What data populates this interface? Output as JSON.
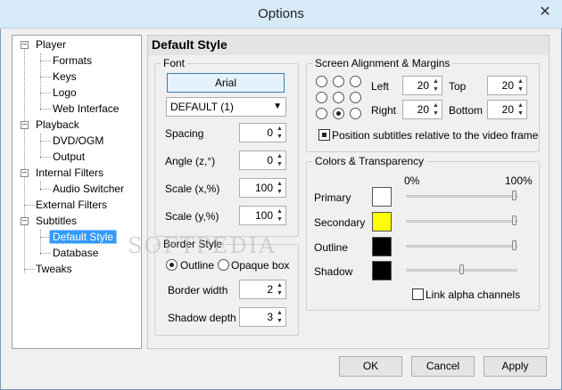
{
  "window": {
    "title": "Options",
    "close_glyph": "✕"
  },
  "tree": {
    "items": [
      {
        "label": "Player",
        "expander": "−"
      },
      {
        "label": "Formats"
      },
      {
        "label": "Keys"
      },
      {
        "label": "Logo"
      },
      {
        "label": "Web Interface"
      },
      {
        "label": "Playback",
        "expander": "−"
      },
      {
        "label": "DVD/OGM"
      },
      {
        "label": "Output"
      },
      {
        "label": "Internal Filters",
        "expander": "−"
      },
      {
        "label": "Audio Switcher"
      },
      {
        "label": "External Filters"
      },
      {
        "label": "Subtitles",
        "expander": "−"
      },
      {
        "label": "Default Style",
        "selected": true
      },
      {
        "label": "Database"
      },
      {
        "label": "Tweaks"
      }
    ]
  },
  "panel": {
    "title": "Default Style"
  },
  "font": {
    "legend": "Font",
    "font_button": "Arial",
    "charset": "DEFAULT (1)",
    "spacing_label": "Spacing",
    "spacing": "0",
    "angle_label": "Angle (z,°)",
    "angle": "0",
    "scalex_label": "Scale (x,%)",
    "scalex": "100",
    "scaley_label": "Scale (y,%)",
    "scaley": "100"
  },
  "border": {
    "legend": "Border Style",
    "outline_label": "Outline",
    "opaque_label": "Opaque box",
    "width_label": "Border width",
    "width": "2",
    "shadow_label": "Shadow depth",
    "shadow": "3"
  },
  "align": {
    "legend": "Screen Alignment & Margins",
    "selected_position": "bottom-center",
    "left_label": "Left",
    "left": "20",
    "top_label": "Top",
    "top": "20",
    "right_label": "Right",
    "right": "20",
    "bottom_label": "Bottom",
    "bottom": "20",
    "relative_label": "Position subtitles relative to the video frame",
    "relative_checked": true
  },
  "colors": {
    "legend": "Colors & Transparency",
    "min_label": "0%",
    "max_label": "100%",
    "rows": [
      {
        "label": "Primary",
        "color": "#ffffff",
        "transparency_pct": 100
      },
      {
        "label": "Secondary",
        "color": "#ffff00",
        "transparency_pct": 100
      },
      {
        "label": "Outline",
        "color": "#000000",
        "transparency_pct": 100
      },
      {
        "label": "Shadow",
        "color": "#000000",
        "transparency_pct": 50
      }
    ],
    "link_label": "Link alpha channels",
    "link_checked": false
  },
  "buttons": {
    "ok": "OK",
    "cancel": "Cancel",
    "apply": "Apply"
  },
  "watermark": "SOFTPEDIA"
}
